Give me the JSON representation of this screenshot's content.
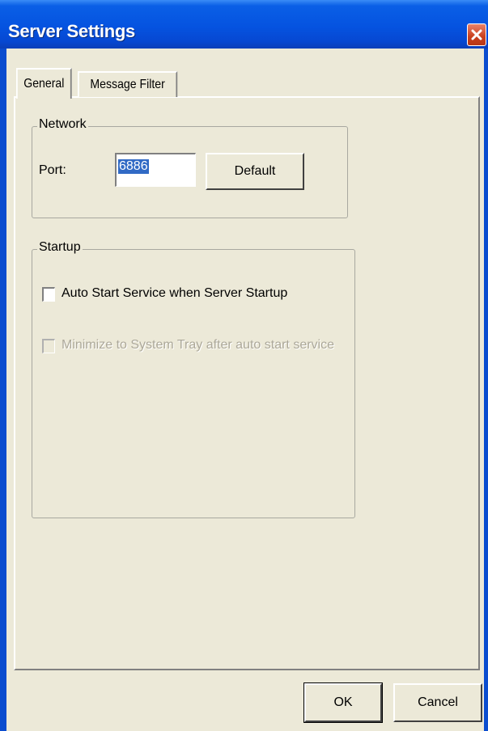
{
  "window": {
    "title": "Server Settings",
    "close_icon": "close-icon"
  },
  "tabs": [
    {
      "label": "General",
      "active": true
    },
    {
      "label": "Message Filter",
      "active": false
    }
  ],
  "network": {
    "legend": "Network",
    "port_label": "Port:",
    "port_value": "6886",
    "default_button": "Default"
  },
  "startup": {
    "legend": "Startup",
    "auto_start": {
      "label": "Auto Start Service when Server Startup",
      "checked": false,
      "enabled": true
    },
    "minimize_tray": {
      "label": "Minimize to System Tray after auto start service",
      "checked": false,
      "enabled": false
    }
  },
  "footer": {
    "ok_label": "OK",
    "cancel_label": "Cancel"
  },
  "colors": {
    "titlebar": "#0553e0",
    "close": "#c9401d",
    "face": "#ece9d8",
    "selection": "#316ac5"
  }
}
